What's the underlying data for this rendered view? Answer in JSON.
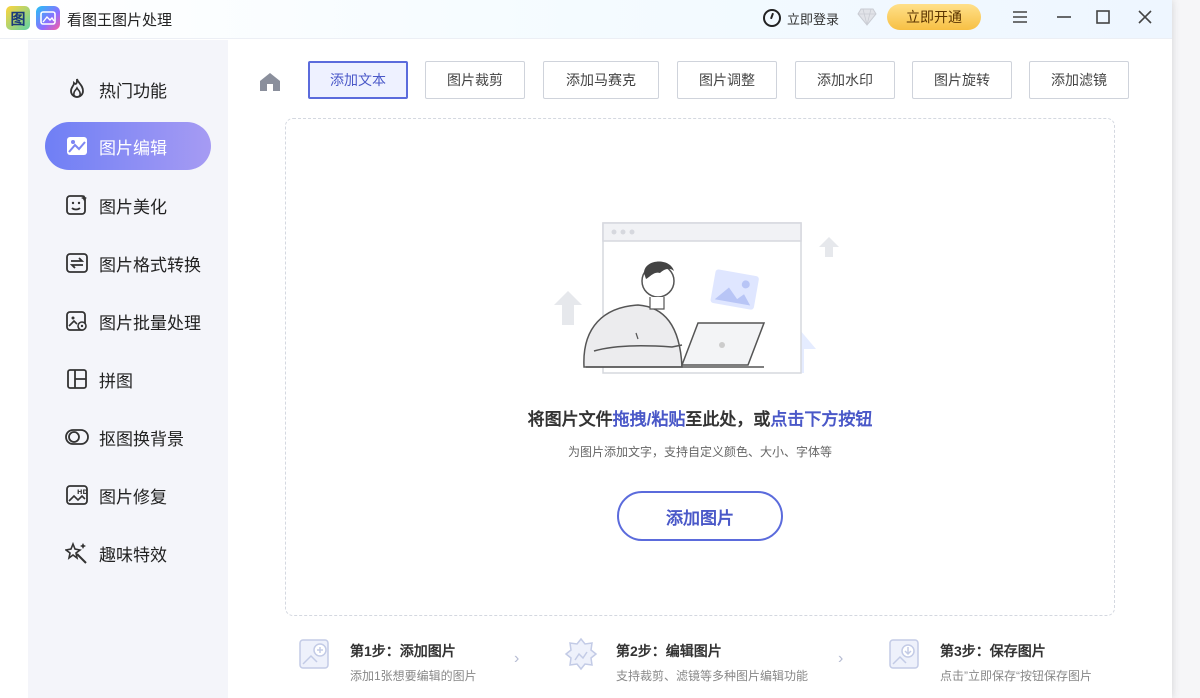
{
  "window": {
    "title": "看图王图片处理",
    "login_label": "立即登录",
    "vip_label": "立即开通",
    "logo_letter": "图"
  },
  "sidebar": {
    "items": [
      {
        "label": "热门功能",
        "icon": "flame-icon"
      },
      {
        "label": "图片编辑",
        "icon": "image-edit-icon",
        "active": true
      },
      {
        "label": "图片美化",
        "icon": "image-beautify-icon"
      },
      {
        "label": "图片格式转换",
        "icon": "format-convert-icon"
      },
      {
        "label": "图片批量处理",
        "icon": "batch-process-icon"
      },
      {
        "label": "拼图",
        "icon": "collage-icon"
      },
      {
        "label": "抠图换背景",
        "icon": "cutout-icon"
      },
      {
        "label": "图片修复",
        "icon": "hd-repair-icon"
      },
      {
        "label": "趣味特效",
        "icon": "magic-effect-icon"
      }
    ]
  },
  "toolbar": {
    "tabs": [
      {
        "label": "添加文本",
        "active": true
      },
      {
        "label": "图片裁剪"
      },
      {
        "label": "添加马赛克"
      },
      {
        "label": "图片调整"
      },
      {
        "label": "添加水印"
      },
      {
        "label": "图片旋转"
      },
      {
        "label": "添加滤镜"
      }
    ]
  },
  "dropzone": {
    "title_part1": "将图片文件",
    "title_highlight1": "拖拽/粘贴",
    "title_part2": "至此处，或",
    "title_highlight2": "点击下方按钮",
    "subtitle": "为图片添加文字，支持自定义颜色、大小、字体等",
    "button_label": "添加图片"
  },
  "steps": [
    {
      "title": "第1步：添加图片",
      "desc": "添加1张想要编辑的图片",
      "icon": "add-image-icon"
    },
    {
      "title": "第2步：编辑图片",
      "desc": "支持裁剪、滤镜等多种图片编辑功能",
      "icon": "edit-image-icon"
    },
    {
      "title": "第3步：保存图片",
      "desc": "点击”立即保存“按钮保存图片",
      "icon": "save-image-icon"
    }
  ],
  "colors": {
    "accent": "#5b6bdc",
    "active_gradient_start": "#6f7ff5",
    "active_gradient_end": "#a69bf3",
    "vip": "#f7c044"
  }
}
